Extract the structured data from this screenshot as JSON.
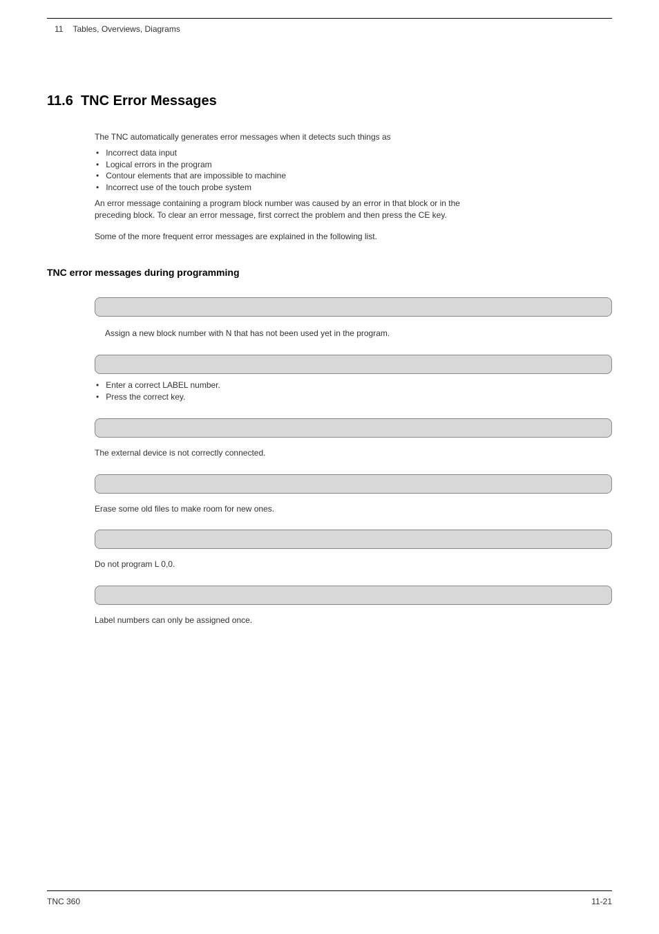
{
  "header": {
    "chapter_number": "11",
    "chapter_title": "Tables, Overviews, Diagrams"
  },
  "section": {
    "number": "11.6",
    "title": "TNC Error Messages"
  },
  "intro": {
    "p1": "The TNC automatically generates error messages when it detects such things as",
    "bullets": [
      "Incorrect data input",
      "Logical errors in the program",
      "Contour elements that are impossible to machine",
      "Incorrect use of the touch probe system"
    ],
    "p2": "An error message containing a program block number was caused by an error in that block or in the preceding block. To clear an error message, first correct the problem and then press the CE key.",
    "p3": "Some of the more frequent error messages are explained in the following list."
  },
  "sub_heading": "TNC error messages during programming",
  "messages": {
    "m1_explanation": "Assign a new block number with N that has not been used yet in the program.",
    "m2_bullets": [
      "Enter a correct LABEL number.",
      "Press the correct key."
    ],
    "m3_explanation": "The external device is not correctly connected.",
    "m4_explanation": "Erase some old files to make room for new ones.",
    "m5_explanation": "Do not program L 0,0.",
    "m6_explanation": "Label numbers can only be assigned once."
  },
  "footer": {
    "left": "TNC 360",
    "right": "11-21"
  }
}
